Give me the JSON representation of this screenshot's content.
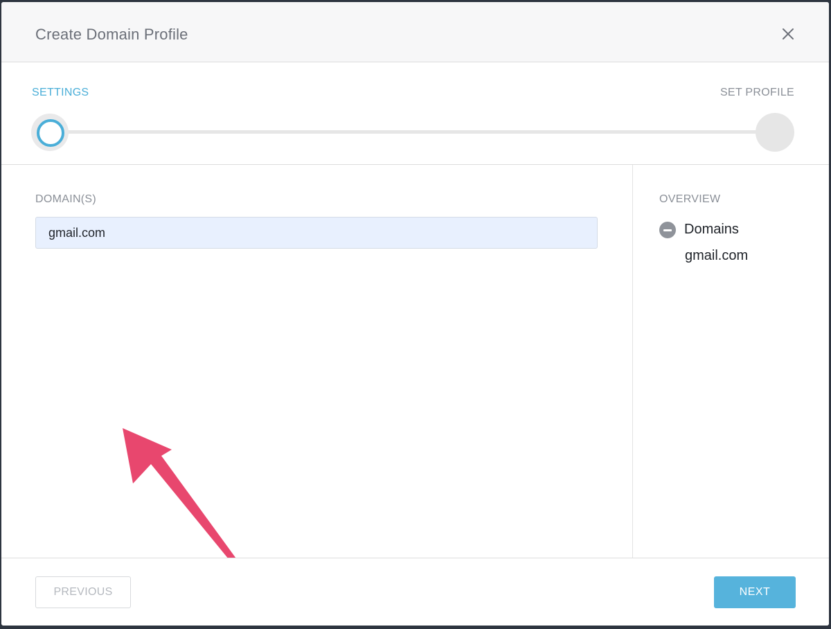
{
  "modal": {
    "title": "Create Domain Profile",
    "close_icon": "close-icon"
  },
  "stepper": {
    "steps": [
      {
        "label": "SETTINGS",
        "state": "active"
      },
      {
        "label": "SET PROFILE",
        "state": "inactive"
      }
    ],
    "accent_color": "#4aaed8"
  },
  "form": {
    "domains_label": "DOMAIN(S)",
    "domains_value": "gmail.com"
  },
  "overview": {
    "label": "OVERVIEW",
    "section_title": "Domains",
    "section_icon": "minus-circle-icon",
    "values": [
      "gmail.com"
    ]
  },
  "footer": {
    "previous_label": "PREVIOUS",
    "next_label": "NEXT"
  },
  "annotation": {
    "arrow_color": "#e8476e"
  }
}
